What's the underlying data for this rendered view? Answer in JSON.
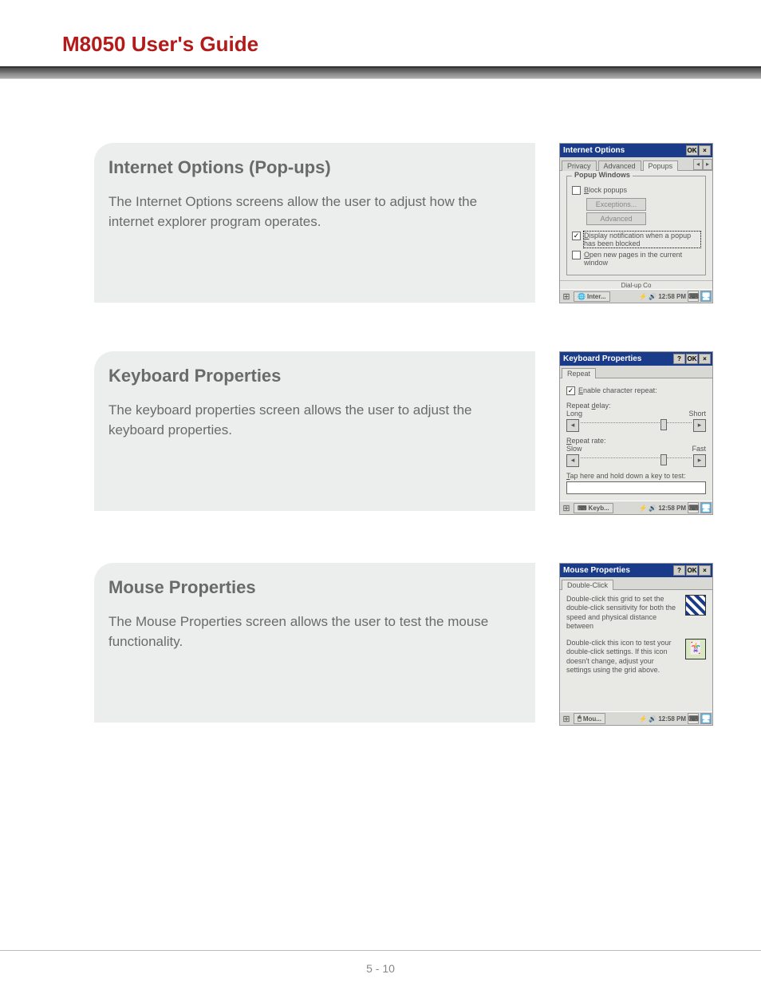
{
  "header": {
    "title": "M8050 User's Guide"
  },
  "footer": {
    "page_label": "5 - 10"
  },
  "sections": [
    {
      "heading": "Internet Options (Pop-ups)",
      "body": "The Internet Options screens allow the user to adjust how the internet explorer program operates."
    },
    {
      "heading": "Keyboard Properties",
      "body": "The keyboard properties screen allows the user to adjust the keyboard properties."
    },
    {
      "heading": "Mouse Properties",
      "body": "The Mouse Properties screen allows the user to test the mouse functionality."
    }
  ],
  "internet_options": {
    "title": "Internet Options",
    "ok": "OK",
    "close": "×",
    "tabs": [
      "Privacy",
      "Advanced",
      "Popups"
    ],
    "scroll_left": "◂",
    "scroll_right": "▸",
    "fieldset_legend": "Popup Windows",
    "block_popups_label": "Block popups",
    "block_underline": "B",
    "exceptions_btn": "Exceptions...",
    "advanced_btn": "Advanced",
    "display_notification_label": "Display notification when a popup has been blocked",
    "display_underline": "D",
    "open_new_pages_label": "Open new pages in the current window",
    "open_underline": "O",
    "dialup_partial": "Dial-up Co",
    "taskbar_app": "Inter...",
    "time": "12:58 PM"
  },
  "keyboard_props": {
    "title": "Keyboard Properties",
    "help": "?",
    "ok": "OK",
    "close": "×",
    "tab": "Repeat",
    "enable_repeat_label": "Enable character repeat:",
    "enable_underline": "E",
    "repeat_delay_label": "Repeat delay:",
    "delay_underline": "d",
    "long": "Long",
    "short": "Short",
    "repeat_rate_label": "Repeat rate:",
    "rate_underline": "R",
    "slow": "Slow",
    "fast": "Fast",
    "tap_label": "Tap here and hold down a key to test:",
    "tap_underline": "T",
    "taskbar_app": "Keyb...",
    "time": "12:58 PM",
    "arrow_left": "◂",
    "arrow_right": "▸"
  },
  "mouse_props": {
    "title": "Mouse Properties",
    "help": "?",
    "ok": "OK",
    "close": "×",
    "tab": "Double-Click",
    "para1": "Double-click this grid to set the double-click sensitivity for both the speed and physical distance between",
    "para2": "Double-click this icon to test your double-click settings. If this icon doesn't change, adjust your settings using the grid above.",
    "taskbar_app": "Mou...",
    "time": "12:58 PM"
  }
}
